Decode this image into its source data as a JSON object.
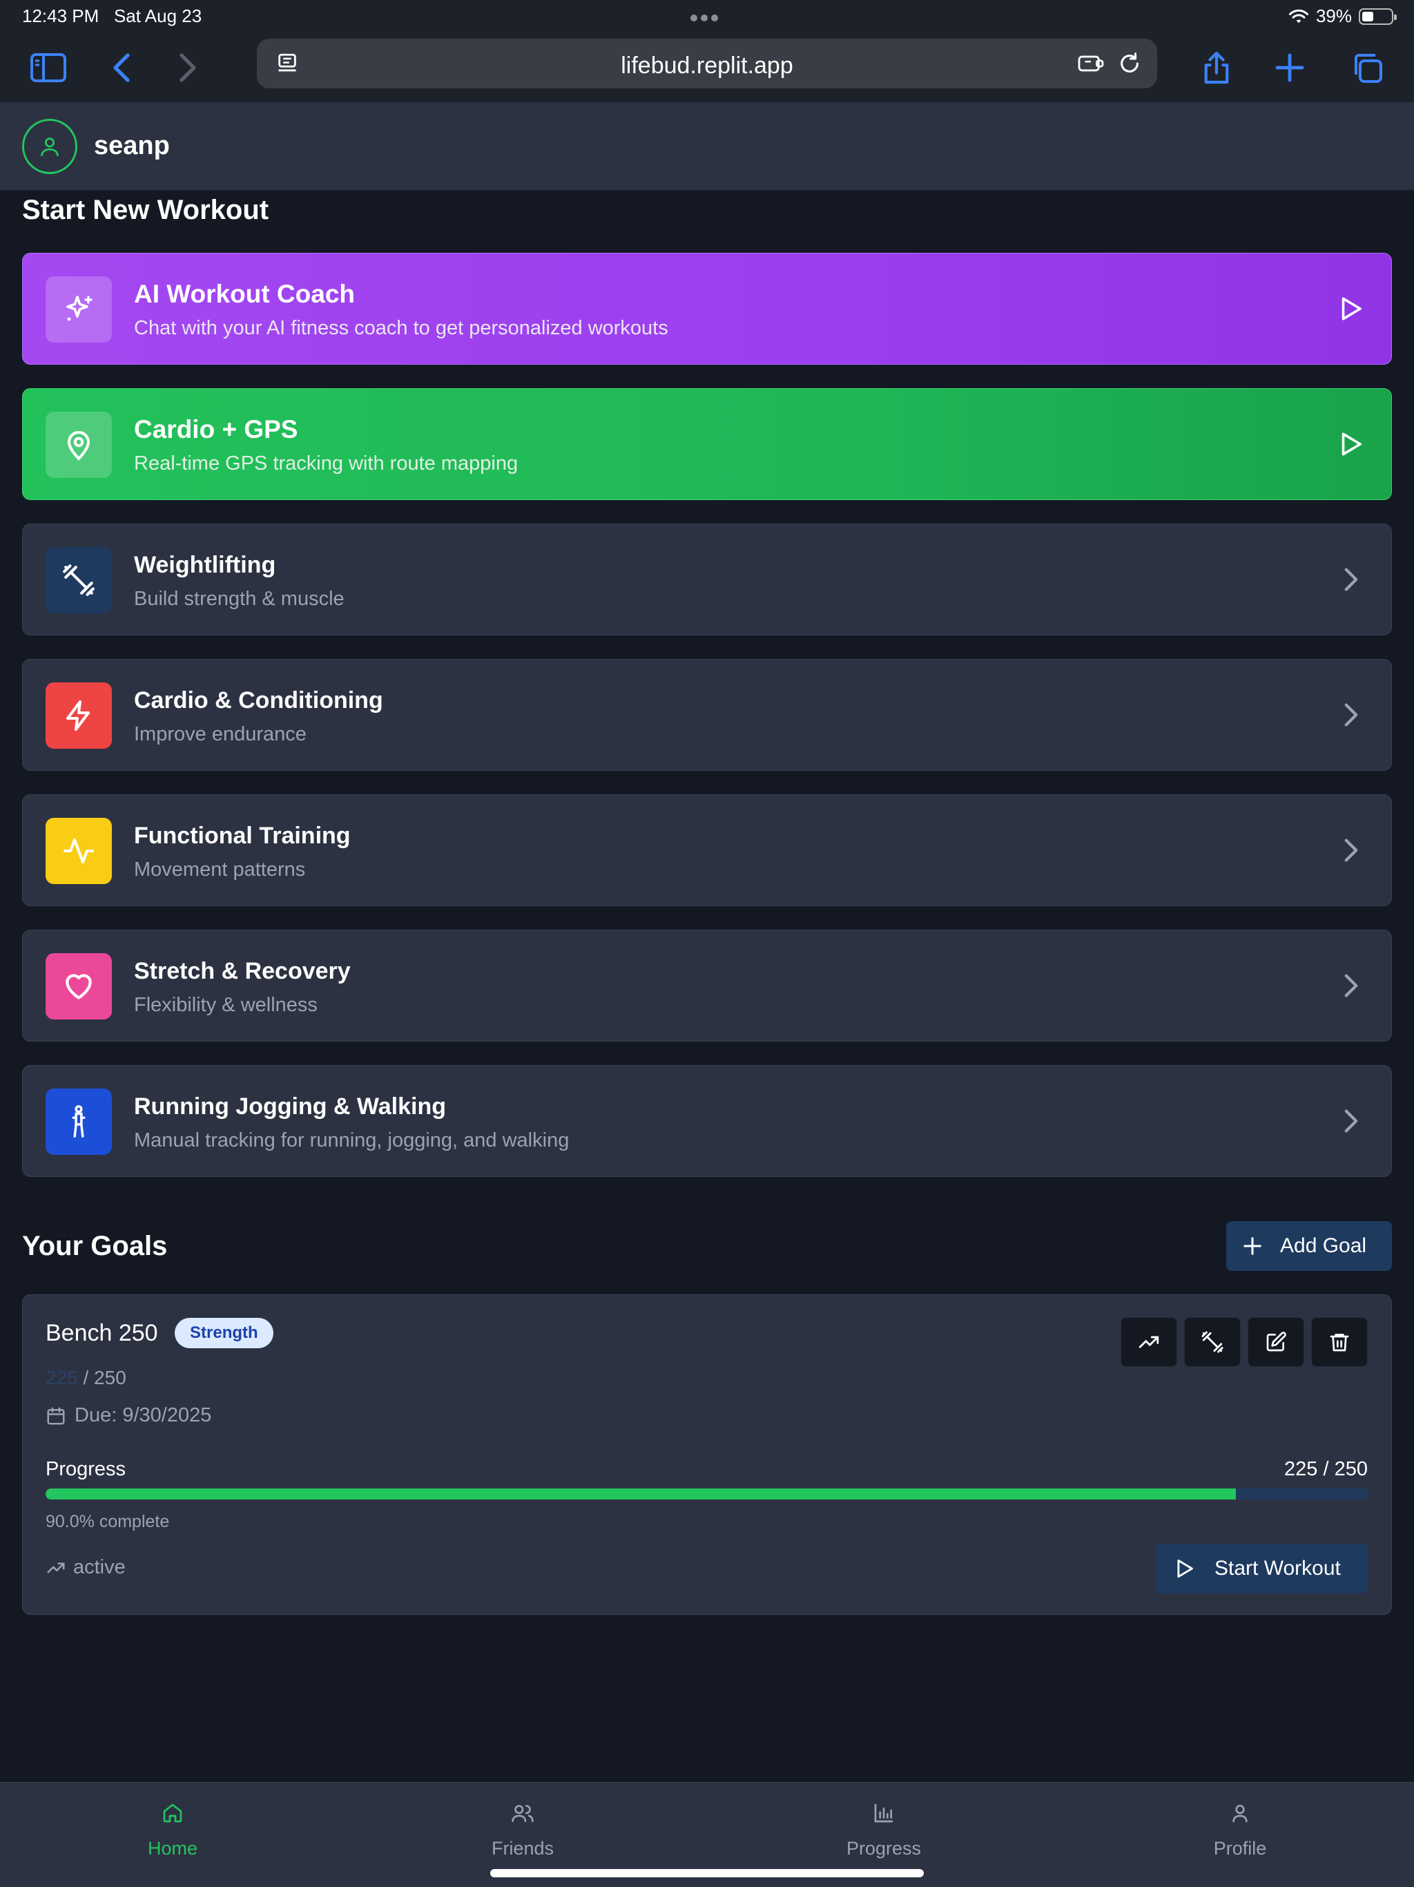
{
  "status_bar": {
    "time": "12:43 PM",
    "date": "Sat Aug 23",
    "battery": "39%"
  },
  "browser": {
    "url": "lifebud.replit.app"
  },
  "header": {
    "username": "seanp"
  },
  "workouts": {
    "title": "Start New Workout",
    "items": [
      {
        "title": "AI Workout Coach",
        "subtitle": "Chat with your AI fitness coach to get personalized workouts",
        "icon": "sparkles-icon",
        "color": "#a448f1"
      },
      {
        "title": "Cardio + GPS",
        "subtitle": "Real-time GPS tracking with route mapping",
        "icon": "map-pin-icon",
        "color": "#22c15a"
      },
      {
        "title": "Weightlifting",
        "subtitle": "Build strength & muscle",
        "icon": "dumbbell-icon",
        "color": "#1e3a5f"
      },
      {
        "title": "Cardio & Conditioning",
        "subtitle": "Improve endurance",
        "icon": "zap-icon",
        "color": "#ef4444"
      },
      {
        "title": "Functional Training",
        "subtitle": "Movement patterns",
        "icon": "activity-icon",
        "color": "#facc15"
      },
      {
        "title": "Stretch & Recovery",
        "subtitle": "Flexibility & wellness",
        "icon": "heart-icon",
        "color": "#ec4899"
      },
      {
        "title": "Running Jogging & Walking",
        "subtitle": "Manual tracking for running, jogging, and walking",
        "icon": "runner-icon",
        "color": "#1d4ed8"
      }
    ]
  },
  "goals": {
    "title": "Your Goals",
    "add_label": "Add Goal",
    "items": [
      {
        "name": "Bench 250",
        "category": "Strength",
        "current": "225",
        "target_suffix": "/ 250",
        "due": "Due: 9/30/2025",
        "progress_label": "Progress",
        "progress_count": "225 / 250",
        "progress_fraction": 0.9,
        "percent_text": "90.0% complete",
        "status": "active",
        "start_label": "Start Workout"
      }
    ]
  },
  "nav": {
    "items": [
      {
        "label": "Home",
        "icon": "home-icon",
        "active": true
      },
      {
        "label": "Friends",
        "icon": "users-icon",
        "active": false
      },
      {
        "label": "Progress",
        "icon": "bar-chart-icon",
        "active": false
      },
      {
        "label": "Profile",
        "icon": "user-icon",
        "active": false
      }
    ]
  },
  "colors": {
    "background": "#131823",
    "card": "#2c3242",
    "accent_green": "#22c55e",
    "accent_blue": "#1e3a5f"
  }
}
